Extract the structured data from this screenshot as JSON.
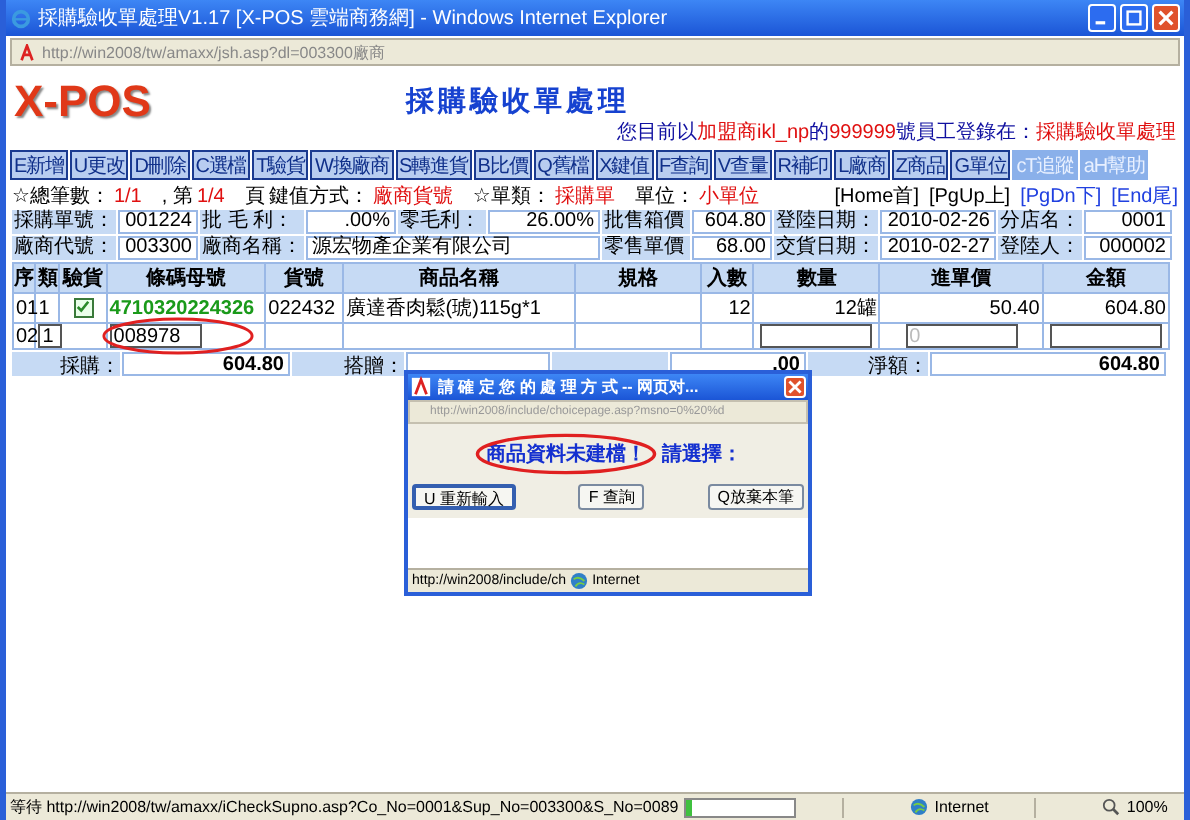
{
  "window": {
    "title": "採購驗收單處理V1.17 [X-POS 雲端商務網] - Windows Internet Explorer",
    "address": "http://win2008/tw/amaxx/jsh.asp?dl=003300廠商"
  },
  "header": {
    "logo": "X-POS",
    "title": "採購驗收單處理",
    "user_line": [
      {
        "text": "您目前以",
        "highlight": false
      },
      {
        "text": "加盟商ikl_np",
        "highlight": true
      },
      {
        "text": "的",
        "highlight": false
      },
      {
        "text": "999999",
        "highlight": true
      },
      {
        "text": "號員工登錄在：",
        "highlight": false
      },
      {
        "text": "採購驗收單處理",
        "highlight": true
      }
    ]
  },
  "toolbar": [
    {
      "label": "E新增",
      "disabled": false
    },
    {
      "label": "U更改",
      "disabled": false
    },
    {
      "label": "D刪除",
      "disabled": false
    },
    {
      "label": "C選檔",
      "disabled": false
    },
    {
      "label": "T驗貨",
      "disabled": false
    },
    {
      "label": "W換廠商",
      "disabled": false
    },
    {
      "label": "S轉進貨",
      "disabled": false
    },
    {
      "label": "B比價",
      "disabled": false
    },
    {
      "label": "Q舊檔",
      "disabled": false
    },
    {
      "label": "X鍵值",
      "disabled": false
    },
    {
      "label": "F查詢",
      "disabled": false
    },
    {
      "label": "V查量",
      "disabled": false
    },
    {
      "label": "R補印",
      "disabled": false
    },
    {
      "label": "L廠商",
      "disabled": false
    },
    {
      "label": "Z商品",
      "disabled": false
    },
    {
      "label": "G單位",
      "disabled": false
    },
    {
      "label": "cT追蹤",
      "disabled": true
    },
    {
      "label": "aH幫助",
      "disabled": true
    }
  ],
  "info": [
    {
      "text": "☆總筆數：",
      "kind": "label"
    },
    {
      "text": "1/1",
      "kind": "value"
    },
    {
      "text": ", 第",
      "kind": "label"
    },
    {
      "text": "1/4",
      "kind": "value"
    },
    {
      "text": "頁",
      "kind": "label"
    },
    {
      "text": "鍵值方式：",
      "kind": "label"
    },
    {
      "text": "廠商貨號",
      "kind": "value"
    },
    {
      "text": "☆單類：",
      "kind": "label"
    },
    {
      "text": "採購單",
      "kind": "value"
    },
    {
      "text": "單位：",
      "kind": "label"
    },
    {
      "text": "小單位",
      "kind": "value"
    }
  ],
  "pager": [
    {
      "label": "[Home首]",
      "disabled": true
    },
    {
      "label": "[PgUp上]",
      "disabled": true
    },
    {
      "label": "[PgDn下]",
      "disabled": false
    },
    {
      "label": "[End尾]",
      "disabled": false
    }
  ],
  "form": [
    [
      {
        "label": "採購單號：",
        "value": "001224"
      },
      {
        "label": "批 毛 利：",
        "value": ".00%"
      },
      {
        "label": "零毛利：",
        "value": "26.00%"
      },
      {
        "label": "批售箱價",
        "value": "604.80"
      },
      {
        "label": "登陸日期：",
        "value": "2010-02-26"
      },
      {
        "label": "分店名：",
        "value": "0001"
      }
    ],
    [
      {
        "label": "廠商代號：",
        "value": "003300"
      },
      {
        "label": "廠商名稱：",
        "value": "源宏物產企業有限公司",
        "wide": true
      },
      {
        "label": "零售單價",
        "value": "68.00"
      },
      {
        "label": "交貨日期：",
        "value": "2010-02-27"
      },
      {
        "label": "登陸人：",
        "value": "000002"
      }
    ]
  ],
  "table": {
    "columns": [
      "序",
      "類",
      "驗貨",
      "條碼母號",
      "貨號",
      "商品名稱",
      "規格",
      "入數",
      "數量",
      "進單價",
      "金額"
    ],
    "rows": [
      {
        "kind": "item",
        "no": "01",
        "type": "1",
        "verified": true,
        "barcode": "4710320224326",
        "code": "022432",
        "name": "廣達香肉鬆(琥)115g*1",
        "pack": "12",
        "qty": "12罐",
        "price": "50.40",
        "amount": "604.80"
      },
      {
        "kind": "entry",
        "no": "02",
        "type": "1",
        "barcode": "008978",
        "circled": true,
        "price_placeholder": "0"
      }
    ]
  },
  "totals": [
    {
      "label": "採購：",
      "value": "604.80"
    },
    {
      "label": "搭贈："
    },
    {
      "value": ".00"
    },
    {
      "label": "淨額：",
      "value": "604.80"
    }
  ],
  "dialog": {
    "title": "請 確 定 您 的 處 理 方 式 -- 网页对...",
    "address": "http://win2008/include/choicepage.asp?msno=0%20%d",
    "message": "商品資料未建檔！",
    "prompt": "請選擇：",
    "buttons": [
      {
        "label": "U 重新輸入",
        "selected": true
      },
      {
        "label": "F 查詢",
        "selected": false
      },
      {
        "label": "Q放棄本筆",
        "selected": false
      }
    ],
    "status": "http://win2008/include/ch",
    "zone": "Internet"
  },
  "status_bar": {
    "text": "等待 http://win2008/tw/amaxx/iCheckSupno.asp?Co_No=0001&Sup_No=003300&S_No=0089",
    "level": 0.05,
    "zone": "Internet",
    "zoom": "100%"
  }
}
